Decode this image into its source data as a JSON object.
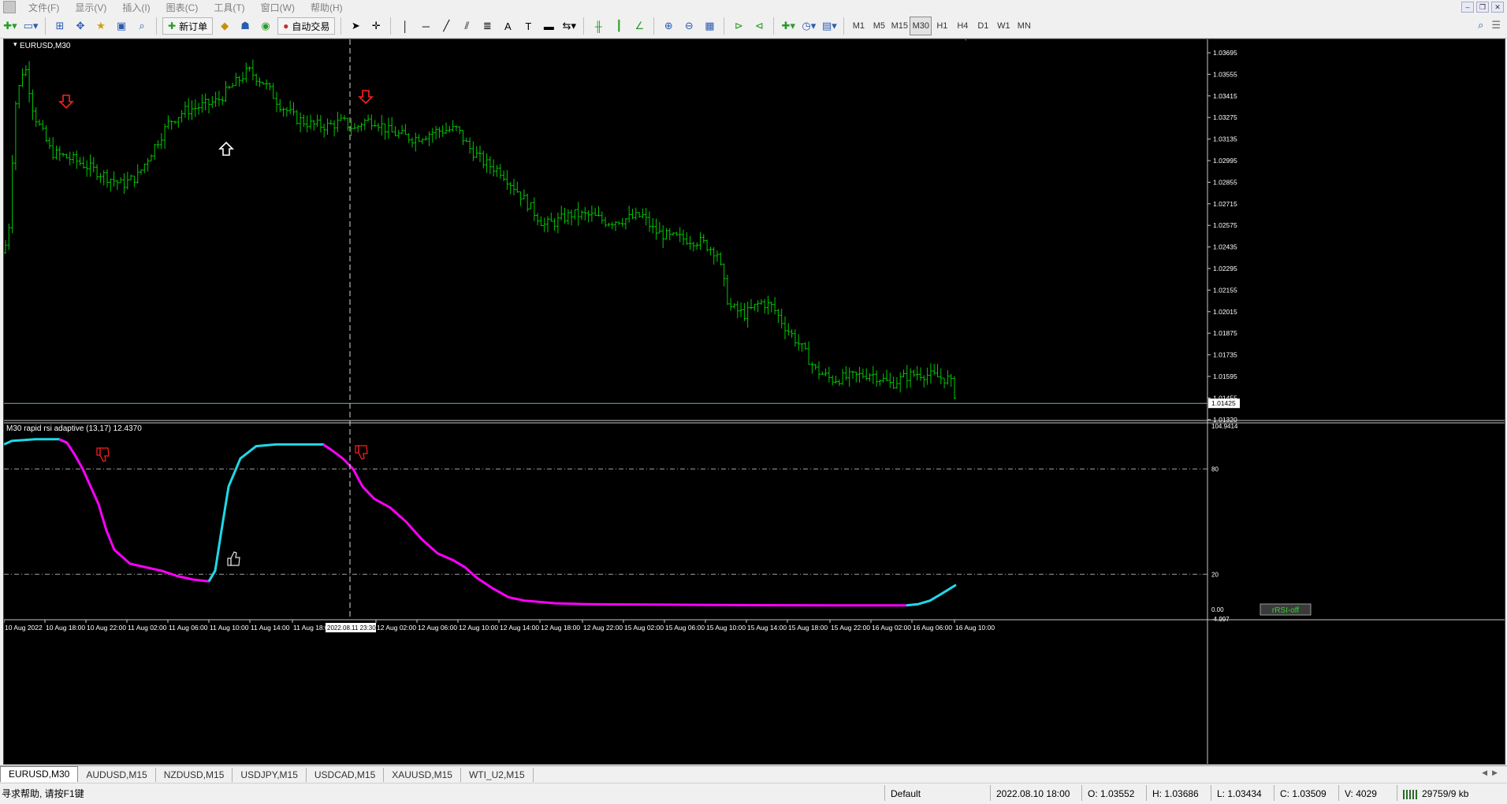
{
  "menu": {
    "items": [
      "文件(F)",
      "显示(V)",
      "插入(I)",
      "图表(C)",
      "工具(T)",
      "窗口(W)",
      "帮助(H)"
    ]
  },
  "toolbar": {
    "new_order_label": "新订单",
    "auto_trade_label": "自动交易",
    "timeframes": [
      "M1",
      "M5",
      "M15",
      "M30",
      "H1",
      "H4",
      "D1",
      "W1",
      "MN"
    ],
    "active_timeframe": "M30"
  },
  "price_chart": {
    "label": "EURUSD,M30",
    "price_levels": [
      "1.03695",
      "1.03555",
      "1.03415",
      "1.03275",
      "1.03135",
      "1.02995",
      "1.02855",
      "1.02715",
      "1.02575",
      "1.02435",
      "1.02295",
      "1.02155",
      "1.02015",
      "1.01875",
      "1.01735",
      "1.01595",
      "1.01455",
      "1.01320"
    ],
    "current_price": "1.01425",
    "bar_color": "#00c800"
  },
  "indicator": {
    "label": "M30 rapid rsi adaptive (13,17) 12.4370",
    "scale_labels": [
      "104.9414",
      "80",
      "20",
      "0.00",
      "-4.997"
    ],
    "bull_color": "#20d8e8",
    "bear_color": "#ff00ff",
    "button_label": "rRSI-off"
  },
  "time_axis": {
    "labels": [
      "10 Aug 2022",
      "10 Aug 18:00",
      "10 Aug 22:00",
      "11 Aug 02:00",
      "11 Aug 06:00",
      "11 Aug 10:00",
      "11 Aug 14:00",
      "11 Aug 18:00",
      "12 Aug 02:00",
      "12 Aug 06:00",
      "12 Aug 10:00",
      "12 Aug 14:00",
      "12 Aug 18:00",
      "12 Aug 22:00",
      "15 Aug 02:00",
      "15 Aug 06:00",
      "15 Aug 10:00",
      "15 Aug 14:00",
      "15 Aug 18:00",
      "15 Aug 22:00",
      "16 Aug 02:00",
      "16 Aug 06:00",
      "16 Aug 10:00"
    ],
    "crosshair_label": "2022.08.11 23:30"
  },
  "tabs": [
    "EURUSD,M30",
    "AUDUSD,M15",
    "NZDUSD,M15",
    "USDJPY,M15",
    "USDCAD,M15",
    "XAUUSD,M15",
    "WTI_U2,M15"
  ],
  "active_tab": 0,
  "status": {
    "help": "寻求帮助, 请按F1键",
    "profile": "Default",
    "datetime": "2022.08.10 18:00",
    "open": "O: 1.03552",
    "high": "H: 1.03686",
    "low": "L: 1.03434",
    "close": "C: 1.03509",
    "volume": "V: 4029",
    "traffic": "29759/9 kb"
  }
}
